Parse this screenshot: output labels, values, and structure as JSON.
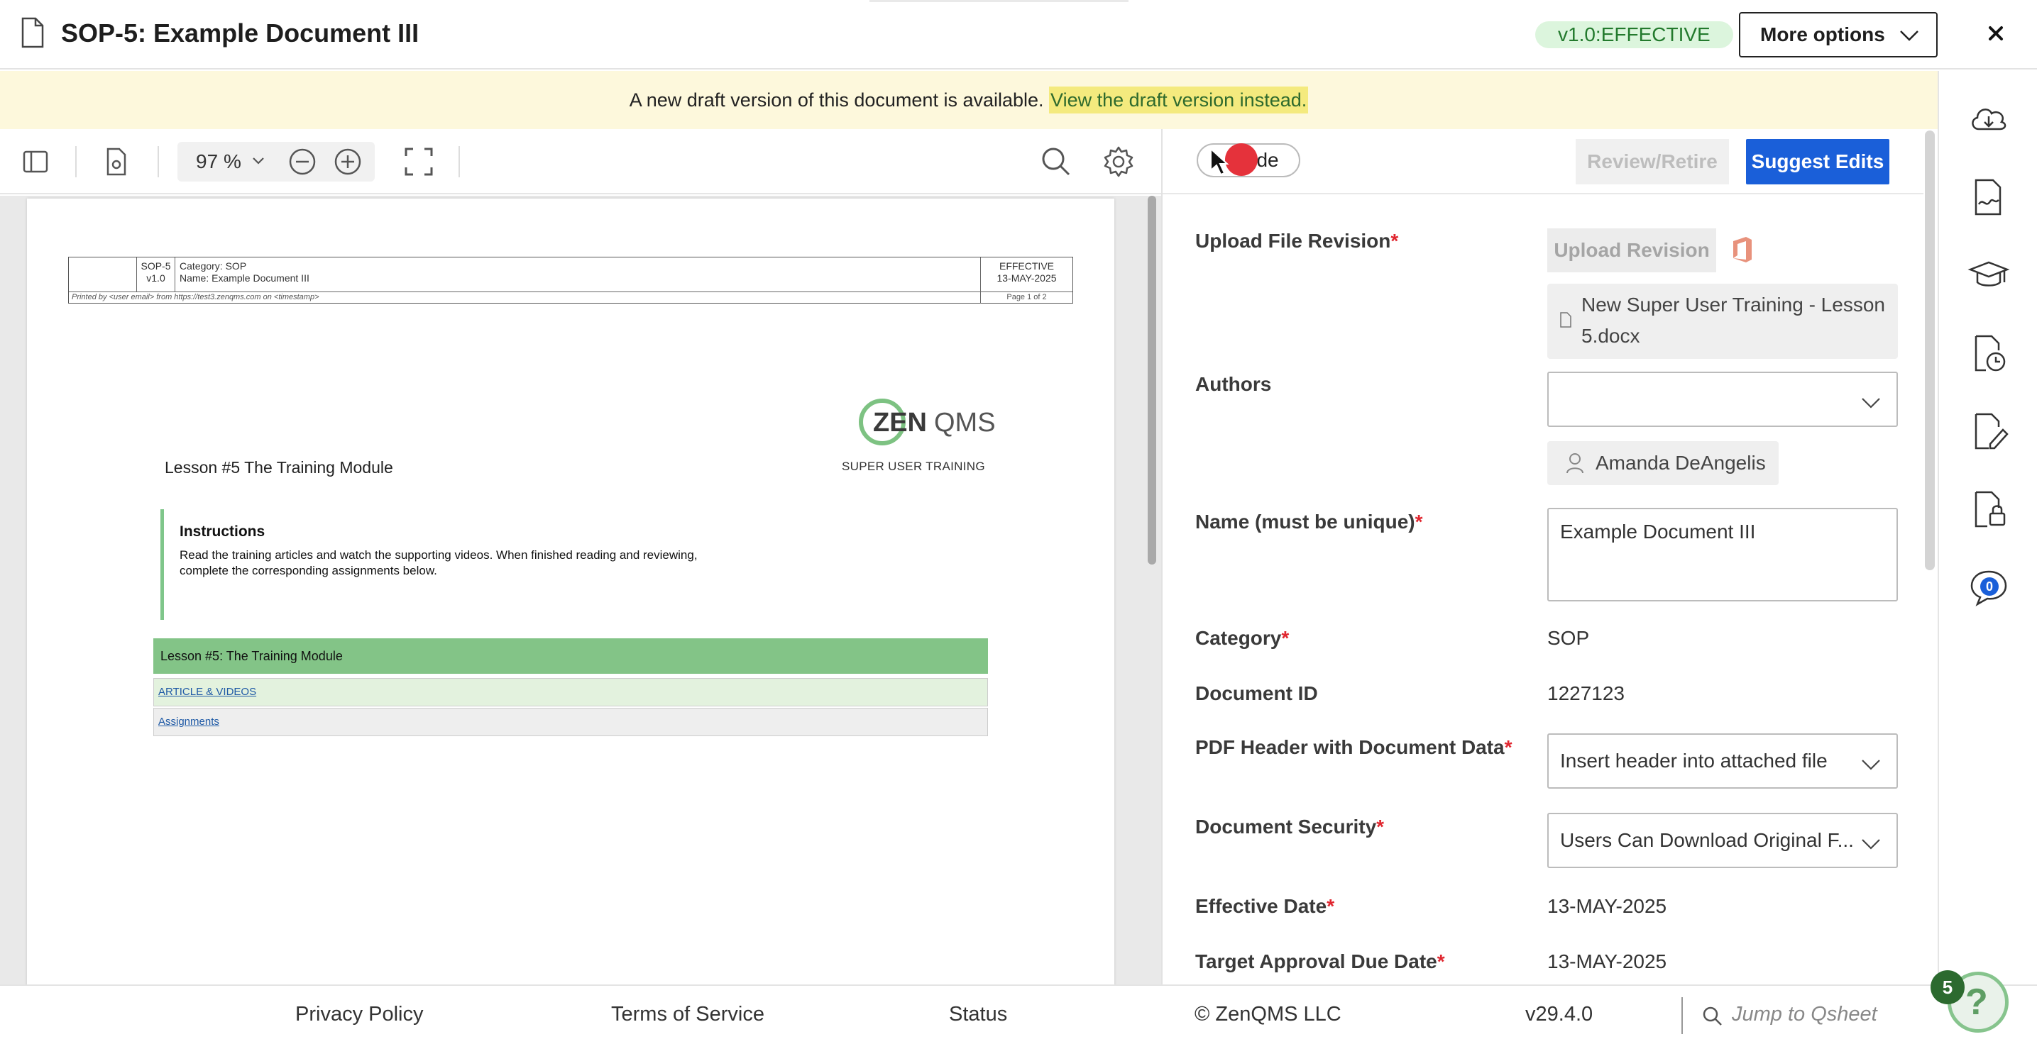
{
  "header": {
    "title": "SOP-5: Example Document III",
    "version_badge": "v1.0:EFFECTIVE",
    "more_options_label": "More options"
  },
  "banner": {
    "text": "A new draft version of this document is available.",
    "link": "View the draft version instead."
  },
  "viewer": {
    "zoom": "97",
    "zoom_unit": "%"
  },
  "document": {
    "header_id": "SOP-5",
    "header_version": "v1.0",
    "header_category_label": "Category:",
    "header_category": "SOP",
    "header_name_label": "Name:",
    "header_name": "Example Document III",
    "header_status": "EFFECTIVE",
    "header_date": "13-MAY-2025",
    "printed_by": "Printed by <user email> from https://test3.zenqms.com on <timestamp>",
    "page_label": "Page 1 of 2",
    "logo_text_zen": "ZEN",
    "logo_text_qms": "QMS",
    "logo_subtitle": "SUPER USER TRAINING",
    "lesson_title": "Lesson #5 The Training Module",
    "instructions_heading": "Instructions",
    "instructions_text": "Read the training articles and watch the supporting videos. When finished reading and reviewing, complete the corresponding assignments below.",
    "table_header": "Lesson #5: The Training Module",
    "row_article": "ARTICLE & VIDEOS",
    "row_assignments": "Assignments"
  },
  "panel": {
    "hide_label": "Hide",
    "review_label": "Review/Retire",
    "suggest_label": "Suggest Edits",
    "upload_label": "Upload File Revision",
    "upload_button": "Upload Revision",
    "file_name_line1": "New Super User Training - Lesson",
    "file_name_line2": "5.docx",
    "authors_label": "Authors",
    "author_name": "Amanda DeAngelis",
    "name_label": "Name (must be unique)",
    "name_value": "Example Document III",
    "category_label": "Category",
    "category_value": "SOP",
    "docid_label": "Document ID",
    "docid_value": "1227123",
    "pdfheader_label": "PDF Header with Document Data",
    "pdfheader_value": "Insert header into attached file",
    "security_label": "Document Security",
    "security_value": "Users Can Download Original F...",
    "effective_label": "Effective Date",
    "effective_value": "13-MAY-2025",
    "target_label": "Target Approval Due Date",
    "target_value": "13-MAY-2025",
    "required_mark": "*"
  },
  "rail": {
    "chat_count": "0"
  },
  "footer": {
    "privacy": "Privacy Policy",
    "terms": "Terms of Service",
    "status": "Status",
    "copyright": "© ZenQMS LLC",
    "version": "v29.4.0",
    "jump_placeholder": "Jump to Qsheet",
    "help_count": "5",
    "help_symbol": "?"
  },
  "colors": {
    "accent_blue": "#1a5fd9",
    "effective_green": "#237a2d",
    "banner_bg": "#fdf8dc",
    "required_red": "#e0262f"
  }
}
